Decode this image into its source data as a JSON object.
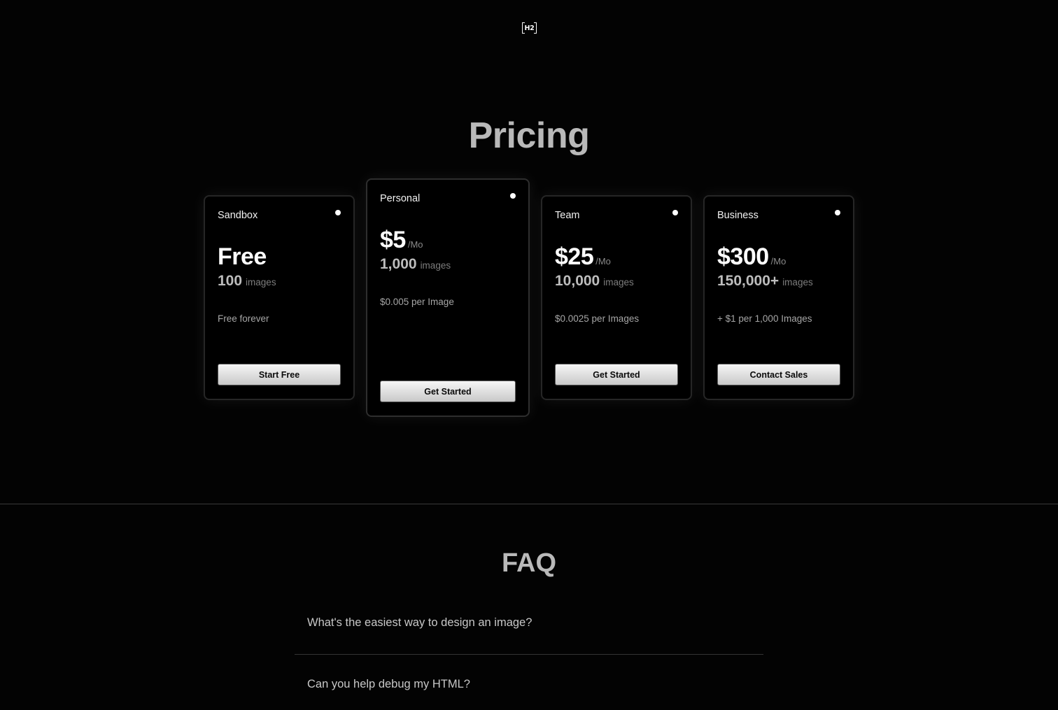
{
  "brand": {
    "logo_text": "H2"
  },
  "pricing": {
    "title": "Pricing",
    "plans": [
      {
        "name": "Sandbox",
        "price": "Free",
        "price_unit": "",
        "quantity": "100",
        "quantity_unit": "images",
        "note": "Free forever",
        "cta": "Start Free"
      },
      {
        "name": "Personal",
        "price": "$5",
        "price_unit": "/Mo",
        "quantity": "1,000",
        "quantity_unit": "images",
        "note": "$0.005 per Image",
        "cta": "Get Started",
        "featured": true
      },
      {
        "name": "Team",
        "price": "$25",
        "price_unit": "/Mo",
        "quantity": "10,000",
        "quantity_unit": "images",
        "note": "$0.0025 per Images",
        "cta": "Get Started"
      },
      {
        "name": "Business",
        "price": "$300",
        "price_unit": "/Mo",
        "quantity": "150,000+",
        "quantity_unit": "images",
        "note": "+ $1 per 1,000 Images",
        "cta": "Contact Sales"
      }
    ]
  },
  "faq": {
    "title": "FAQ",
    "questions": [
      "What's the easiest way to design an image?",
      "Can you help debug my HTML?"
    ]
  },
  "colors": {
    "background": "#030303",
    "title": "#b9b9b9",
    "card_border": "#262626"
  }
}
